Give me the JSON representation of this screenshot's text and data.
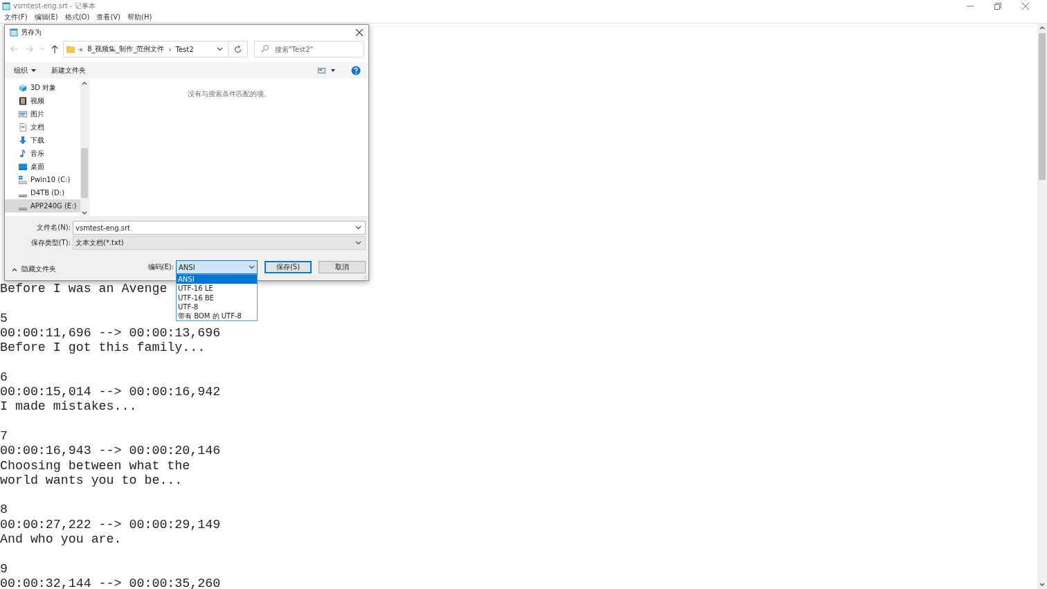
{
  "notepad": {
    "title": "vsmtest-eng.srt - 记事本",
    "menu": [
      "文件(F)",
      "编辑(E)",
      "格式(O)",
      "查看(V)",
      "帮助(H)"
    ],
    "subtitles": [
      {
        "lines": [
          "Before I was an Avenge"
        ]
      },
      {
        "index": "5",
        "time": "00:00:11,696 --> 00:00:13,696",
        "lines": [
          "Before I got this family..."
        ]
      },
      {
        "index": "6",
        "time": "00:00:15,014 --> 00:00:16,942",
        "lines": [
          "I made mistakes..."
        ]
      },
      {
        "index": "7",
        "time": "00:00:16,943 --> 00:00:20,146",
        "lines": [
          "Choosing between what the",
          "world wants you to be..."
        ]
      },
      {
        "index": "8",
        "time": "00:00:27,222 --> 00:00:29,149",
        "lines": [
          "And who you are."
        ]
      },
      {
        "index": "9",
        "time": "00:00:32,144 --> 00:00:35,260"
      }
    ]
  },
  "save_dialog": {
    "title": "另存为",
    "address": {
      "overflow": "«",
      "segments": [
        "8_视频集_制作_范例文件",
        "Test2"
      ],
      "separator": "›"
    },
    "search": {
      "placeholder": "搜索\"Test2\""
    },
    "toolbar": {
      "organize": "组织",
      "new_folder": "新建文件夹"
    },
    "nav_items": [
      {
        "label": "3D 对象",
        "kind": "cube",
        "selected": false
      },
      {
        "label": "视频",
        "kind": "video",
        "selected": false
      },
      {
        "label": "图片",
        "kind": "pictures",
        "selected": false
      },
      {
        "label": "文档",
        "kind": "document",
        "selected": false
      },
      {
        "label": "下载",
        "kind": "download",
        "selected": false
      },
      {
        "label": "音乐",
        "kind": "music",
        "selected": false
      },
      {
        "label": "桌面",
        "kind": "desktop",
        "selected": false
      },
      {
        "label": "Pwin10 (C:)",
        "kind": "system_drive",
        "selected": false
      },
      {
        "label": "D4TB (D:)",
        "kind": "drive",
        "selected": false
      },
      {
        "label": "APP240G (E:)",
        "kind": "drive",
        "selected": true
      }
    ],
    "empty_message": "没有与搜索条件匹配的项。",
    "file_name": {
      "label": "文件名(N):",
      "value": "vsmtest-eng.srt"
    },
    "save_type": {
      "label": "保存类型(T):",
      "value": "文本文档(*.txt)"
    },
    "hide_folders": "隐藏文件夹",
    "encoding": {
      "label": "编码(E):",
      "value": "ANSI",
      "expanded": true,
      "options": [
        {
          "label": "ANSI",
          "selected": true
        },
        {
          "label": "UTF-16 LE",
          "selected": false
        },
        {
          "label": "UTF-16 BE",
          "selected": false
        },
        {
          "label": "UTF-8",
          "selected": false
        },
        {
          "label": "带有 BOM 的 UTF-8",
          "selected": false
        }
      ]
    },
    "buttons": [
      {
        "label": "保存(S)",
        "kind": "primary"
      },
      {
        "label": "取消",
        "kind": "normal"
      }
    ]
  }
}
